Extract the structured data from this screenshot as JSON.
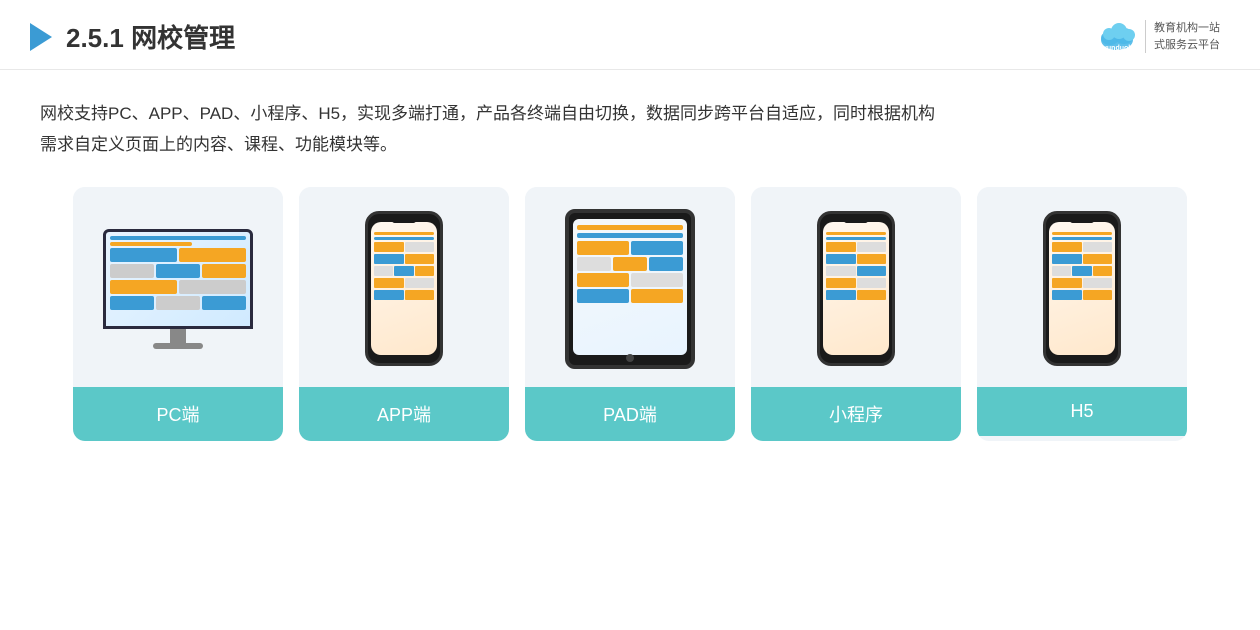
{
  "header": {
    "title_prefix": "2.5.1 ",
    "title_bold": "网校管理",
    "brand": {
      "name": "云朵课堂",
      "domain": "yunduoketang.com",
      "tagline1": "教育机构一站",
      "tagline2": "式服务云平台"
    }
  },
  "description": {
    "text1": "网校支持PC、APP、PAD、小程序、H5，实现多端打通，产品各终端自由切换，数据同步跨平台自适应，同时根据机构",
    "text2": "需求自定义页面上的内容、课程、功能模块等。"
  },
  "cards": [
    {
      "id": "pc",
      "label": "PC端"
    },
    {
      "id": "app",
      "label": "APP端"
    },
    {
      "id": "pad",
      "label": "PAD端"
    },
    {
      "id": "miniprogram",
      "label": "小程序"
    },
    {
      "id": "h5",
      "label": "H5"
    }
  ]
}
